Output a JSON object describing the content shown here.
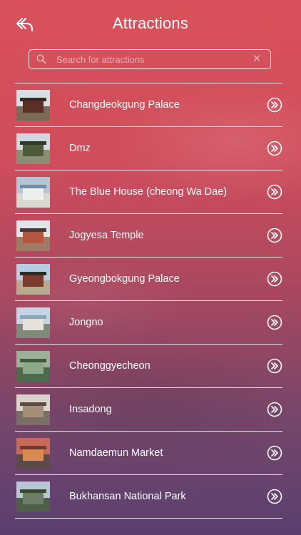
{
  "header": {
    "title": "Attractions",
    "back_icon": "back-arrow-icon"
  },
  "search": {
    "placeholder": "Search for attractions",
    "value": "",
    "icon": "search-icon",
    "clear_icon": "clear-icon"
  },
  "attractions": [
    {
      "label": "Changdeokgung Palace",
      "thumb": {
        "sky": "#d7dfe6",
        "ground": "#7b6a55",
        "bldg": "#5a3026",
        "roof": "#3a2a22"
      }
    },
    {
      "label": "Dmz",
      "thumb": {
        "sky": "#cfd8de",
        "ground": "#8a8f73",
        "bldg": "#4f5a3a",
        "roof": "#2f3a28"
      }
    },
    {
      "label": "The Blue House (cheong Wa Dae)",
      "thumb": {
        "sky": "#b7c4d4",
        "ground": "#d9d9d2",
        "bldg": "#eef0ee",
        "roof": "#6f8ea8"
      }
    },
    {
      "label": "Jogyesa Temple",
      "thumb": {
        "sky": "#dfe5ea",
        "ground": "#9b7d66",
        "bldg": "#b6543d",
        "roof": "#4a3a33"
      }
    },
    {
      "label": "Gyeongbokgung Palace",
      "thumb": {
        "sky": "#b9cde2",
        "ground": "#b9a991",
        "bldg": "#7a3b2c",
        "roof": "#2f2a26"
      }
    },
    {
      "label": "Jongno",
      "thumb": {
        "sky": "#c4d6e6",
        "ground": "#7f8a7a",
        "bldg": "#e4e2db",
        "roof": "#90a3b3"
      }
    },
    {
      "label": "Cheonggyecheon",
      "thumb": {
        "sky": "#9fb09a",
        "ground": "#4d6b4b",
        "bldg": "#8ea88a",
        "roof": "#3f5a3f"
      }
    },
    {
      "label": "Insadong",
      "thumb": {
        "sky": "#d8d3cb",
        "ground": "#7a6f66",
        "bldg": "#a48d79",
        "roof": "#5a4b40"
      }
    },
    {
      "label": "Namdaemun Market",
      "thumb": {
        "sky": "#c66a5a",
        "ground": "#5b4a47",
        "bldg": "#d88a52",
        "roof": "#6a3b35"
      }
    },
    {
      "label": "Bukhansan National Park",
      "thumb": {
        "sky": "#b6c7d6",
        "ground": "#4d5f44",
        "bldg": "#6e7d66",
        "roof": "#3b4a35"
      }
    }
  ],
  "row_action_icon": "double-chevron-right-icon"
}
